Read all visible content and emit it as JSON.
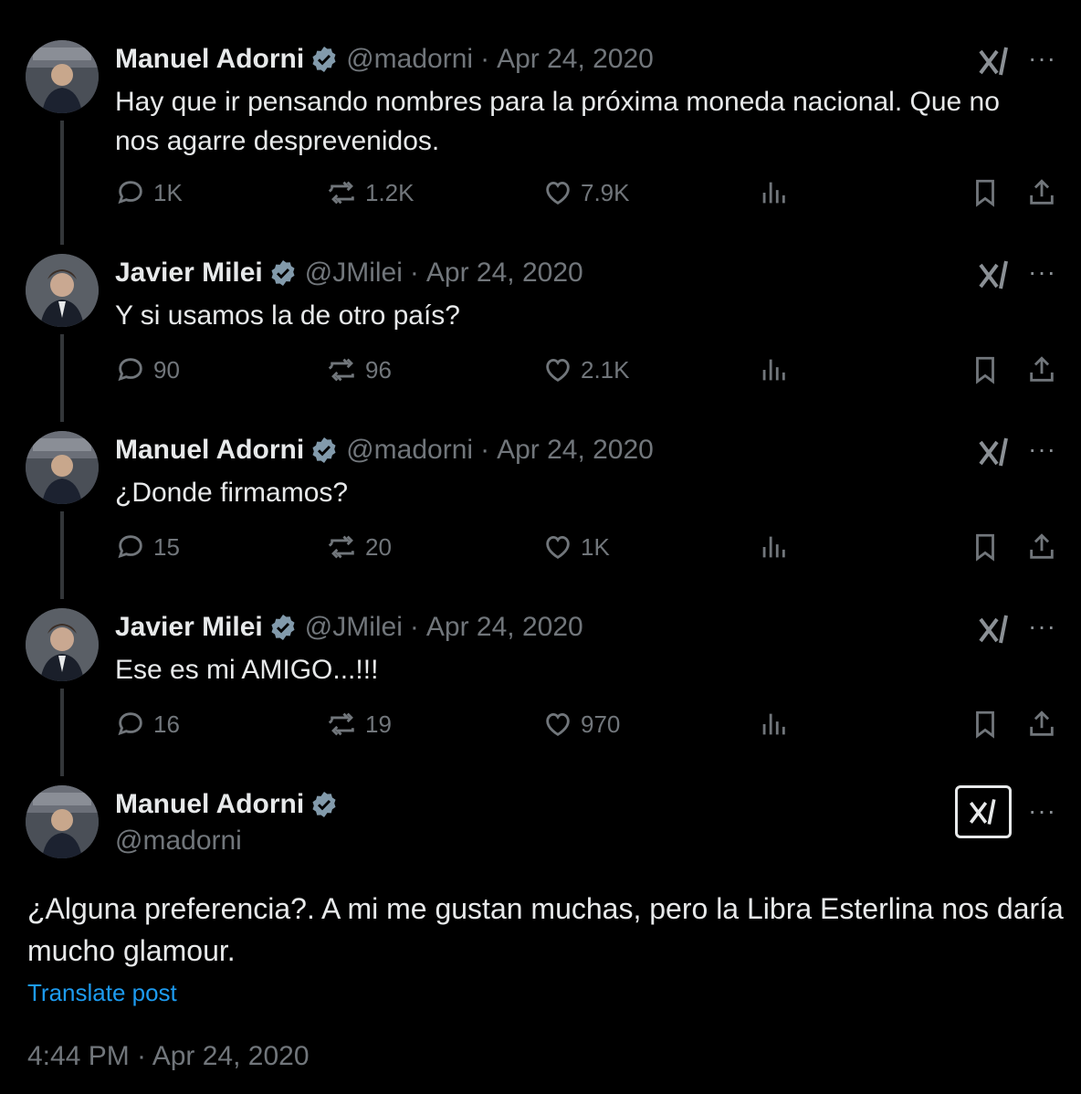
{
  "colors": {
    "background": "#000000",
    "text": "#e7e9ea",
    "muted": "#71767b",
    "link": "#1d9bf0",
    "verified": "#829aab"
  },
  "thread": [
    {
      "name": "Manuel Adorni",
      "handle": "@madorni",
      "date": "Apr 24, 2020",
      "text": "Hay que ir pensando nombres para la próxima moneda nacional. Que no nos agarre desprevenidos.",
      "replies": "1K",
      "reposts": "1.2K",
      "likes": "7.9K"
    },
    {
      "name": "Javier Milei",
      "handle": "@JMilei",
      "date": "Apr 24, 2020",
      "text": "Y si usamos la de otro país?",
      "replies": "90",
      "reposts": "96",
      "likes": "2.1K"
    },
    {
      "name": "Manuel Adorni",
      "handle": "@madorni",
      "date": "Apr 24, 2020",
      "text": "¿Donde firmamos?",
      "replies": "15",
      "reposts": "20",
      "likes": "1K"
    },
    {
      "name": "Javier Milei",
      "handle": "@JMilei",
      "date": "Apr 24, 2020",
      "text": "Ese es mi AMIGO...!!!",
      "replies": "16",
      "reposts": "19",
      "likes": "970"
    }
  ],
  "main": {
    "name": "Manuel Adorni",
    "handle": "@madorni",
    "text": "¿Alguna preferencia?. A mi me gustan muchas, pero la Libra Esterlina nos daría mucho glamour.",
    "translate": "Translate post",
    "timestamp": "4:44 PM · Apr 24, 2020"
  },
  "separator": "·",
  "more_glyph": "···",
  "icons": [
    "verified-badge-icon",
    "grok-icon",
    "more-icon",
    "reply-icon",
    "repost-icon",
    "like-icon",
    "views-icon",
    "bookmark-icon",
    "share-icon"
  ]
}
